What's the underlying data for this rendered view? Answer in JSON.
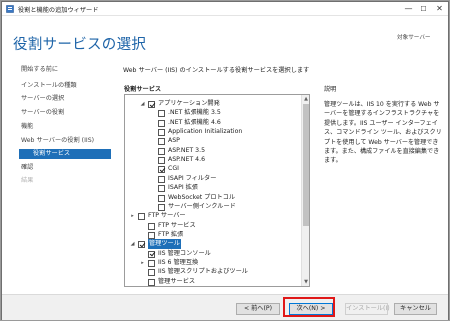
{
  "window": {
    "title": "役割と機能の追加ウィザード",
    "controls": {
      "minimize": "—",
      "maximize": "☐",
      "close": "✕"
    }
  },
  "banner": {
    "heading": "役割サービスの選択",
    "server": "対象サーバー"
  },
  "sidebar": {
    "items": [
      {
        "label": "開始する前に",
        "state": "normal"
      },
      {
        "label": "インストールの種類",
        "state": "normal"
      },
      {
        "label": "サーバーの選択",
        "state": "normal"
      },
      {
        "label": "サーバーの役割",
        "state": "normal"
      },
      {
        "label": "機能",
        "state": "normal"
      },
      {
        "label": "Web サーバーの役割 (IIS)",
        "state": "normal"
      },
      {
        "label": "役割サービス",
        "state": "active"
      },
      {
        "label": "確認",
        "state": "normal"
      },
      {
        "label": "結果",
        "state": "disabled"
      }
    ]
  },
  "main": {
    "instruction": "Web サーバー (IIS) のインストールする役割サービスを選択します",
    "roles_label": "役割サービス",
    "description_label": "説明",
    "description_text": "管理ツールは、IIS 10 を実行する Web サーバーを管理するインフラストラクチャを提供します。IIS ユーザー インターフェイス、コマンドライン ツール、およびスクリプトを使用して Web サーバーを管理できます。また、構成ファイルを直接編集できます。"
  },
  "roles": [
    {
      "label": "アプリケーション開発",
      "level": 1,
      "expander": "◢",
      "checked": true,
      "highlight": false
    },
    {
      "label": ".NET 拡張機能 3.5",
      "level": 2,
      "expander": "",
      "checked": false,
      "highlight": false
    },
    {
      "label": ".NET 拡張機能 4.6",
      "level": 2,
      "expander": "",
      "checked": false,
      "highlight": false
    },
    {
      "label": "Application Initialization",
      "level": 2,
      "expander": "",
      "checked": false,
      "highlight": false
    },
    {
      "label": "ASP",
      "level": 2,
      "expander": "",
      "checked": false,
      "highlight": false
    },
    {
      "label": "ASP.NET 3.5",
      "level": 2,
      "expander": "",
      "checked": false,
      "highlight": false
    },
    {
      "label": "ASP.NET 4.6",
      "level": 2,
      "expander": "",
      "checked": false,
      "highlight": false
    },
    {
      "label": "CGI",
      "level": 2,
      "expander": "",
      "checked": true,
      "highlight": false
    },
    {
      "label": "ISAPI フィルター",
      "level": 2,
      "expander": "",
      "checked": false,
      "highlight": false
    },
    {
      "label": "ISAPI 拡張",
      "level": 2,
      "expander": "",
      "checked": false,
      "highlight": false
    },
    {
      "label": "WebSocket プロトコル",
      "level": 2,
      "expander": "",
      "checked": false,
      "highlight": false
    },
    {
      "label": "サーバー側インクルード",
      "level": 2,
      "expander": "",
      "checked": false,
      "highlight": false
    },
    {
      "label": "FTP サーバー",
      "level": 0,
      "expander": "▸",
      "checked": false,
      "highlight": false
    },
    {
      "label": "FTP サービス",
      "level": 1,
      "expander": "",
      "checked": false,
      "highlight": false
    },
    {
      "label": "FTP 拡張",
      "level": 1,
      "expander": "",
      "checked": false,
      "highlight": false
    },
    {
      "label": "管理ツール",
      "level": 0,
      "expander": "◢",
      "checked": true,
      "highlight": true
    },
    {
      "label": "IIS 管理コンソール",
      "level": 1,
      "expander": "",
      "checked": true,
      "highlight": false
    },
    {
      "label": "IIS 6 管理互換",
      "level": 1,
      "expander": "▸",
      "checked": false,
      "highlight": false
    },
    {
      "label": "IIS 管理スクリプトおよびツール",
      "level": 1,
      "expander": "",
      "checked": false,
      "highlight": false
    },
    {
      "label": "管理サービス",
      "level": 1,
      "expander": "",
      "checked": false,
      "highlight": false
    }
  ],
  "scrollbar": {
    "up": "▲",
    "down": "▼"
  },
  "footer": {
    "prev": "< 前へ(P)",
    "next": "次へ(N) >",
    "install": "インストール(I)",
    "cancel": "キャンセル"
  },
  "colors": {
    "heading": "#1e64a8",
    "active": "#1e6fb8",
    "highlight_box": "#e01818"
  }
}
